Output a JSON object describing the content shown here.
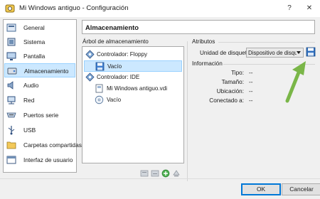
{
  "window": {
    "title": "Mi Windows antiguo - Configuración",
    "help_glyph": "?",
    "close_glyph": "✕"
  },
  "sidebar": {
    "items": [
      {
        "label": "General",
        "icon": "general-icon"
      },
      {
        "label": "Sistema",
        "icon": "system-icon"
      },
      {
        "label": "Pantalla",
        "icon": "display-icon"
      },
      {
        "label": "Almacenamiento",
        "icon": "storage-icon"
      },
      {
        "label": "Audio",
        "icon": "audio-icon"
      },
      {
        "label": "Red",
        "icon": "network-icon"
      },
      {
        "label": "Puertos serie",
        "icon": "serial-ports-icon"
      },
      {
        "label": "USB",
        "icon": "usb-icon"
      },
      {
        "label": "Carpetas compartidas",
        "icon": "shared-folders-icon"
      },
      {
        "label": "Interfaz de usuario",
        "icon": "user-interface-icon"
      }
    ],
    "selected": "Almacenamiento"
  },
  "main": {
    "section_title": "Almacenamiento",
    "tree_label": "Árbol de almacenamiento",
    "tree": {
      "floppy_controller": "Controlador: Floppy",
      "floppy_empty": "Vacío",
      "ide_controller": "Controlador: IDE",
      "vdi": "Mi Windows antiguo.vdi",
      "ide_empty": "Vacío"
    },
    "attributes": {
      "heading": "Atributos",
      "disk_label": "Unidad de disquete:",
      "disk_value": "Dispositivo de disque"
    },
    "info": {
      "heading": "Información",
      "rows": [
        {
          "label": "Tipo:",
          "value": "--"
        },
        {
          "label": "Tamaño:",
          "value": "--"
        },
        {
          "label": "Ubicación:",
          "value": "--"
        },
        {
          "label": "Conectado a:",
          "value": "--"
        }
      ]
    }
  },
  "buttons": {
    "ok": "OK",
    "cancel": "Cancelar"
  },
  "colors": {
    "selection": "#cce8ff",
    "annotation_arrow": "#7ab648",
    "accent": "#0078d7"
  }
}
